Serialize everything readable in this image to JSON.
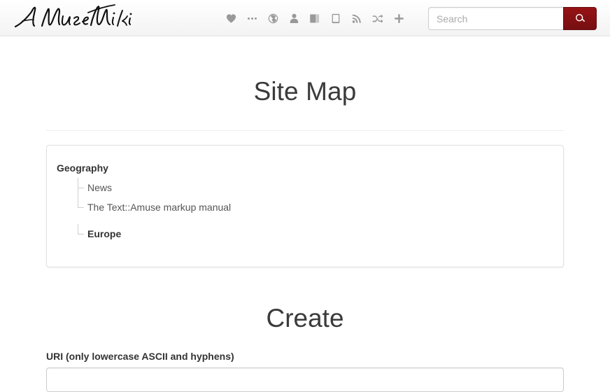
{
  "navbar": {
    "brand_text": "A MuseWiki",
    "icons": [
      {
        "name": "heart-icon",
        "glyph": "heart",
        "label": "Favorites"
      },
      {
        "name": "ellipsis-icon",
        "glyph": "ellipsis",
        "label": "More"
      },
      {
        "name": "globe-icon",
        "glyph": "globe",
        "label": "Language"
      },
      {
        "name": "user-icon",
        "glyph": "user",
        "label": "Author"
      },
      {
        "name": "book-icon",
        "glyph": "book",
        "label": "Library"
      },
      {
        "name": "tablet-icon",
        "glyph": "tablet",
        "label": "Reader"
      },
      {
        "name": "rss-icon",
        "glyph": "rss",
        "label": "Feed"
      },
      {
        "name": "random-icon",
        "glyph": "random",
        "label": "Random"
      },
      {
        "name": "plus-icon",
        "glyph": "plus",
        "label": "Add"
      }
    ],
    "search": {
      "placeholder": "Search",
      "value": "",
      "button_icon": "search-icon"
    }
  },
  "main": {
    "page_title": "Site Map",
    "sitemap": {
      "root_label": "Geography",
      "groups": [
        {
          "items": [
            {
              "label": "News",
              "bold": false
            },
            {
              "label": "The Text::Amuse markup manual",
              "bold": false
            }
          ]
        },
        {
          "items": [
            {
              "label": "Europe",
              "bold": true
            }
          ]
        }
      ]
    },
    "create": {
      "heading": "Create",
      "uri_label": "URI (only lowercase ASCII and hyphens)",
      "uri_value": "",
      "uri_placeholder": ""
    }
  },
  "colors": {
    "accent_red": "#8B1012",
    "text_dark": "#333333",
    "text_muted": "#555555",
    "border": "#e0e0e0",
    "icon_gray": "#999999"
  }
}
